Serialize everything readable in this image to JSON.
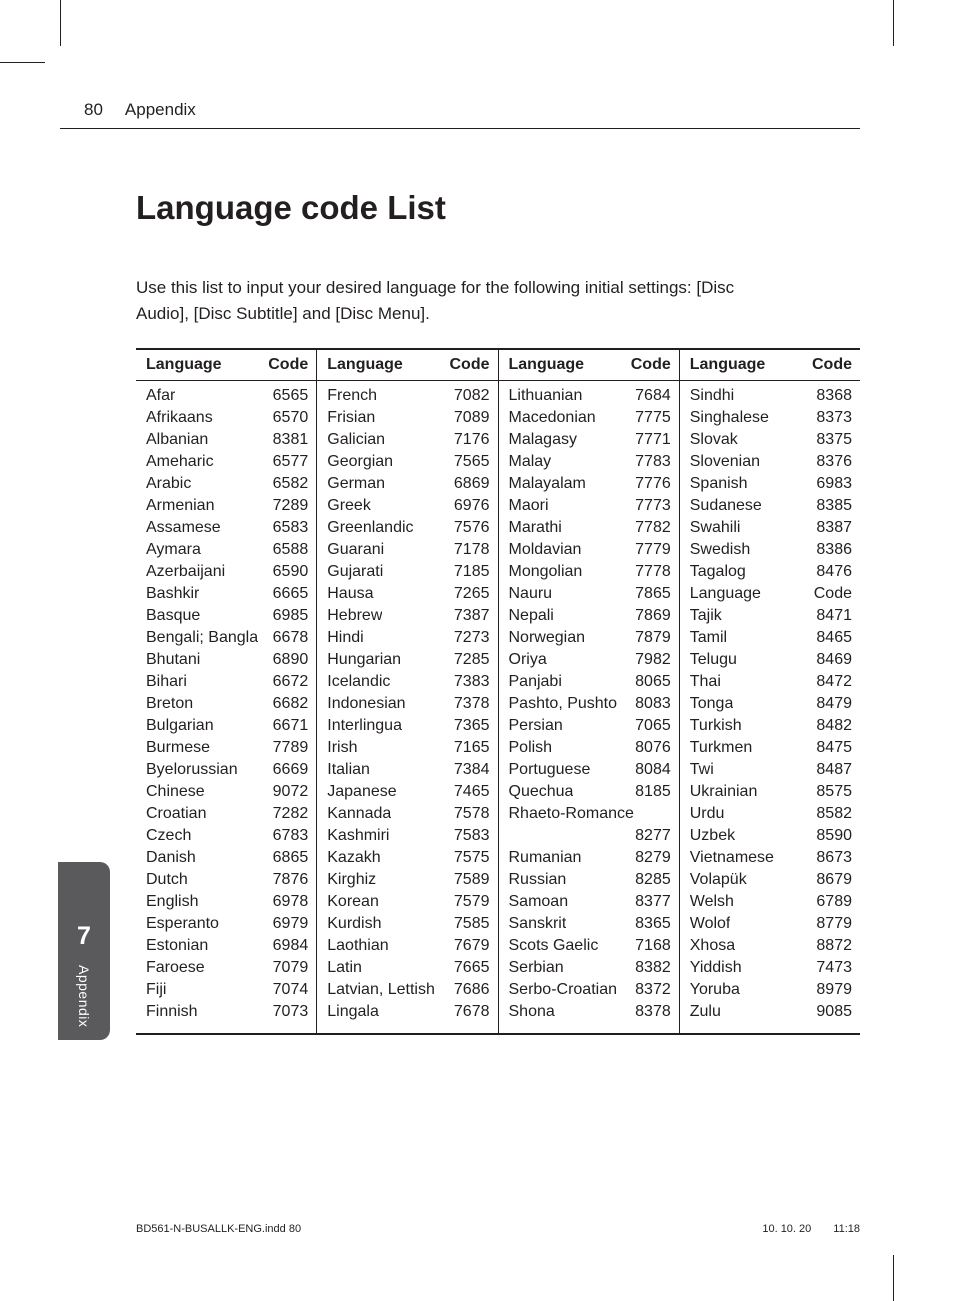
{
  "page_number": "80",
  "section_label": "Appendix",
  "title": "Language code List",
  "intro": "Use this list to input your desired language for the following initial settings: [Disc Audio], [Disc Subtitle] and [Disc Menu].",
  "col_headers": {
    "lang": "Language",
    "code": "Code"
  },
  "columns": [
    [
      {
        "lang": "Afar",
        "code": "6565"
      },
      {
        "lang": "Afrikaans",
        "code": "6570"
      },
      {
        "lang": "Albanian",
        "code": "8381"
      },
      {
        "lang": "Ameharic",
        "code": "6577"
      },
      {
        "lang": "Arabic",
        "code": "6582"
      },
      {
        "lang": "Armenian",
        "code": "7289"
      },
      {
        "lang": "Assamese",
        "code": "6583"
      },
      {
        "lang": "Aymara",
        "code": "6588"
      },
      {
        "lang": "Azerbaijani",
        "code": "6590"
      },
      {
        "lang": "Bashkir",
        "code": "6665"
      },
      {
        "lang": "Basque",
        "code": "6985"
      },
      {
        "lang": "Bengali; Bangla",
        "code": "6678"
      },
      {
        "lang": "Bhutani",
        "code": "6890"
      },
      {
        "lang": "Bihari",
        "code": "6672"
      },
      {
        "lang": "Breton",
        "code": "6682"
      },
      {
        "lang": "Bulgarian",
        "code": "6671"
      },
      {
        "lang": "Burmese",
        "code": "7789"
      },
      {
        "lang": "Byelorussian",
        "code": "6669"
      },
      {
        "lang": "Chinese",
        "code": "9072"
      },
      {
        "lang": "Croatian",
        "code": "7282"
      },
      {
        "lang": "Czech",
        "code": "6783"
      },
      {
        "lang": "Danish",
        "code": "6865"
      },
      {
        "lang": "Dutch",
        "code": "7876"
      },
      {
        "lang": "English",
        "code": "6978"
      },
      {
        "lang": "Esperanto",
        "code": "6979"
      },
      {
        "lang": "Estonian",
        "code": "6984"
      },
      {
        "lang": "Faroese",
        "code": "7079"
      },
      {
        "lang": "Fiji",
        "code": "7074"
      },
      {
        "lang": "Finnish",
        "code": "7073"
      }
    ],
    [
      {
        "lang": "French",
        "code": "7082"
      },
      {
        "lang": "Frisian",
        "code": "7089"
      },
      {
        "lang": "Galician",
        "code": "7176"
      },
      {
        "lang": "Georgian",
        "code": "7565"
      },
      {
        "lang": "German",
        "code": "6869"
      },
      {
        "lang": "Greek",
        "code": "6976"
      },
      {
        "lang": "Greenlandic",
        "code": "7576"
      },
      {
        "lang": "Guarani",
        "code": "7178"
      },
      {
        "lang": "Gujarati",
        "code": "7185"
      },
      {
        "lang": "Hausa",
        "code": "7265"
      },
      {
        "lang": "Hebrew",
        "code": "7387"
      },
      {
        "lang": "Hindi",
        "code": "7273"
      },
      {
        "lang": "Hungarian",
        "code": "7285"
      },
      {
        "lang": "Icelandic",
        "code": "7383"
      },
      {
        "lang": "Indonesian",
        "code": "7378"
      },
      {
        "lang": "Interlingua",
        "code": "7365"
      },
      {
        "lang": "Irish",
        "code": "7165"
      },
      {
        "lang": "Italian",
        "code": "7384"
      },
      {
        "lang": "Japanese",
        "code": "7465"
      },
      {
        "lang": "Kannada",
        "code": "7578"
      },
      {
        "lang": "Kashmiri",
        "code": "7583"
      },
      {
        "lang": "Kazakh",
        "code": "7575"
      },
      {
        "lang": "Kirghiz",
        "code": "7589"
      },
      {
        "lang": "Korean",
        "code": "7579"
      },
      {
        "lang": "Kurdish",
        "code": "7585"
      },
      {
        "lang": "Laothian",
        "code": "7679"
      },
      {
        "lang": "Latin",
        "code": "7665"
      },
      {
        "lang": "Latvian, Lettish",
        "code": "7686"
      },
      {
        "lang": "Lingala",
        "code": "7678"
      }
    ],
    [
      {
        "lang": "Lithuanian",
        "code": "7684"
      },
      {
        "lang": "Macedonian",
        "code": "7775"
      },
      {
        "lang": "Malagasy",
        "code": "7771"
      },
      {
        "lang": "Malay",
        "code": "7783"
      },
      {
        "lang": "Malayalam",
        "code": "7776"
      },
      {
        "lang": "Maori",
        "code": "7773"
      },
      {
        "lang": "Marathi",
        "code": "7782"
      },
      {
        "lang": "Moldavian",
        "code": "7779"
      },
      {
        "lang": "Mongolian",
        "code": "7778"
      },
      {
        "lang": "Nauru",
        "code": "7865"
      },
      {
        "lang": "Nepali",
        "code": "7869"
      },
      {
        "lang": "Norwegian",
        "code": "7879"
      },
      {
        "lang": "Oriya",
        "code": "7982"
      },
      {
        "lang": "Panjabi",
        "code": "8065"
      },
      {
        "lang": "Pashto, Pushto",
        "code": "8083"
      },
      {
        "lang": "Persian",
        "code": "7065"
      },
      {
        "lang": "Polish",
        "code": "8076"
      },
      {
        "lang": "Portuguese",
        "code": "8084"
      },
      {
        "lang": "Quechua",
        "code": "8185"
      },
      {
        "lang": "Rhaeto-Romance",
        "code": ""
      },
      {
        "lang": "",
        "code": "8277"
      },
      {
        "lang": "Rumanian",
        "code": "8279"
      },
      {
        "lang": "Russian",
        "code": "8285"
      },
      {
        "lang": "Samoan",
        "code": "8377"
      },
      {
        "lang": "Sanskrit",
        "code": "8365"
      },
      {
        "lang": "Scots Gaelic",
        "code": "7168"
      },
      {
        "lang": "Serbian",
        "code": "8382"
      },
      {
        "lang": "Serbo-Croatian",
        "code": "8372"
      },
      {
        "lang": "Shona",
        "code": "8378"
      }
    ],
    [
      {
        "lang": "Sindhi",
        "code": "8368"
      },
      {
        "lang": "Singhalese",
        "code": "8373"
      },
      {
        "lang": "Slovak",
        "code": "8375"
      },
      {
        "lang": "Slovenian",
        "code": "8376"
      },
      {
        "lang": "Spanish",
        "code": "6983"
      },
      {
        "lang": "Sudanese",
        "code": "8385"
      },
      {
        "lang": "Swahili",
        "code": "8387"
      },
      {
        "lang": "Swedish",
        "code": "8386"
      },
      {
        "lang": "Tagalog",
        "code": "8476"
      },
      {
        "lang": "Language",
        "code": "Code"
      },
      {
        "lang": "Tajik",
        "code": "8471"
      },
      {
        "lang": "Tamil",
        "code": "8465"
      },
      {
        "lang": "Telugu",
        "code": "8469"
      },
      {
        "lang": "Thai",
        "code": "8472"
      },
      {
        "lang": "Tonga",
        "code": "8479"
      },
      {
        "lang": "Turkish",
        "code": "8482"
      },
      {
        "lang": "Turkmen",
        "code": "8475"
      },
      {
        "lang": "Twi",
        "code": "8487"
      },
      {
        "lang": "Ukrainian",
        "code": "8575"
      },
      {
        "lang": "Urdu",
        "code": "8582"
      },
      {
        "lang": "Uzbek",
        "code": "8590"
      },
      {
        "lang": "Vietnamese",
        "code": "8673"
      },
      {
        "lang": "Volapük",
        "code": "8679"
      },
      {
        "lang": "Welsh",
        "code": "6789"
      },
      {
        "lang": "Wolof",
        "code": "8779"
      },
      {
        "lang": "Xhosa",
        "code": "8872"
      },
      {
        "lang": "Yiddish",
        "code": "7473"
      },
      {
        "lang": "Yoruba",
        "code": "8979"
      },
      {
        "lang": "Zulu",
        "code": "9085"
      }
    ]
  ],
  "side_tab": {
    "num": "7",
    "label": "Appendix"
  },
  "footer": {
    "file": "BD561-N-BUSALLK-ENG.indd   80",
    "date": "10. 10. 20",
    "time": "11:18"
  }
}
